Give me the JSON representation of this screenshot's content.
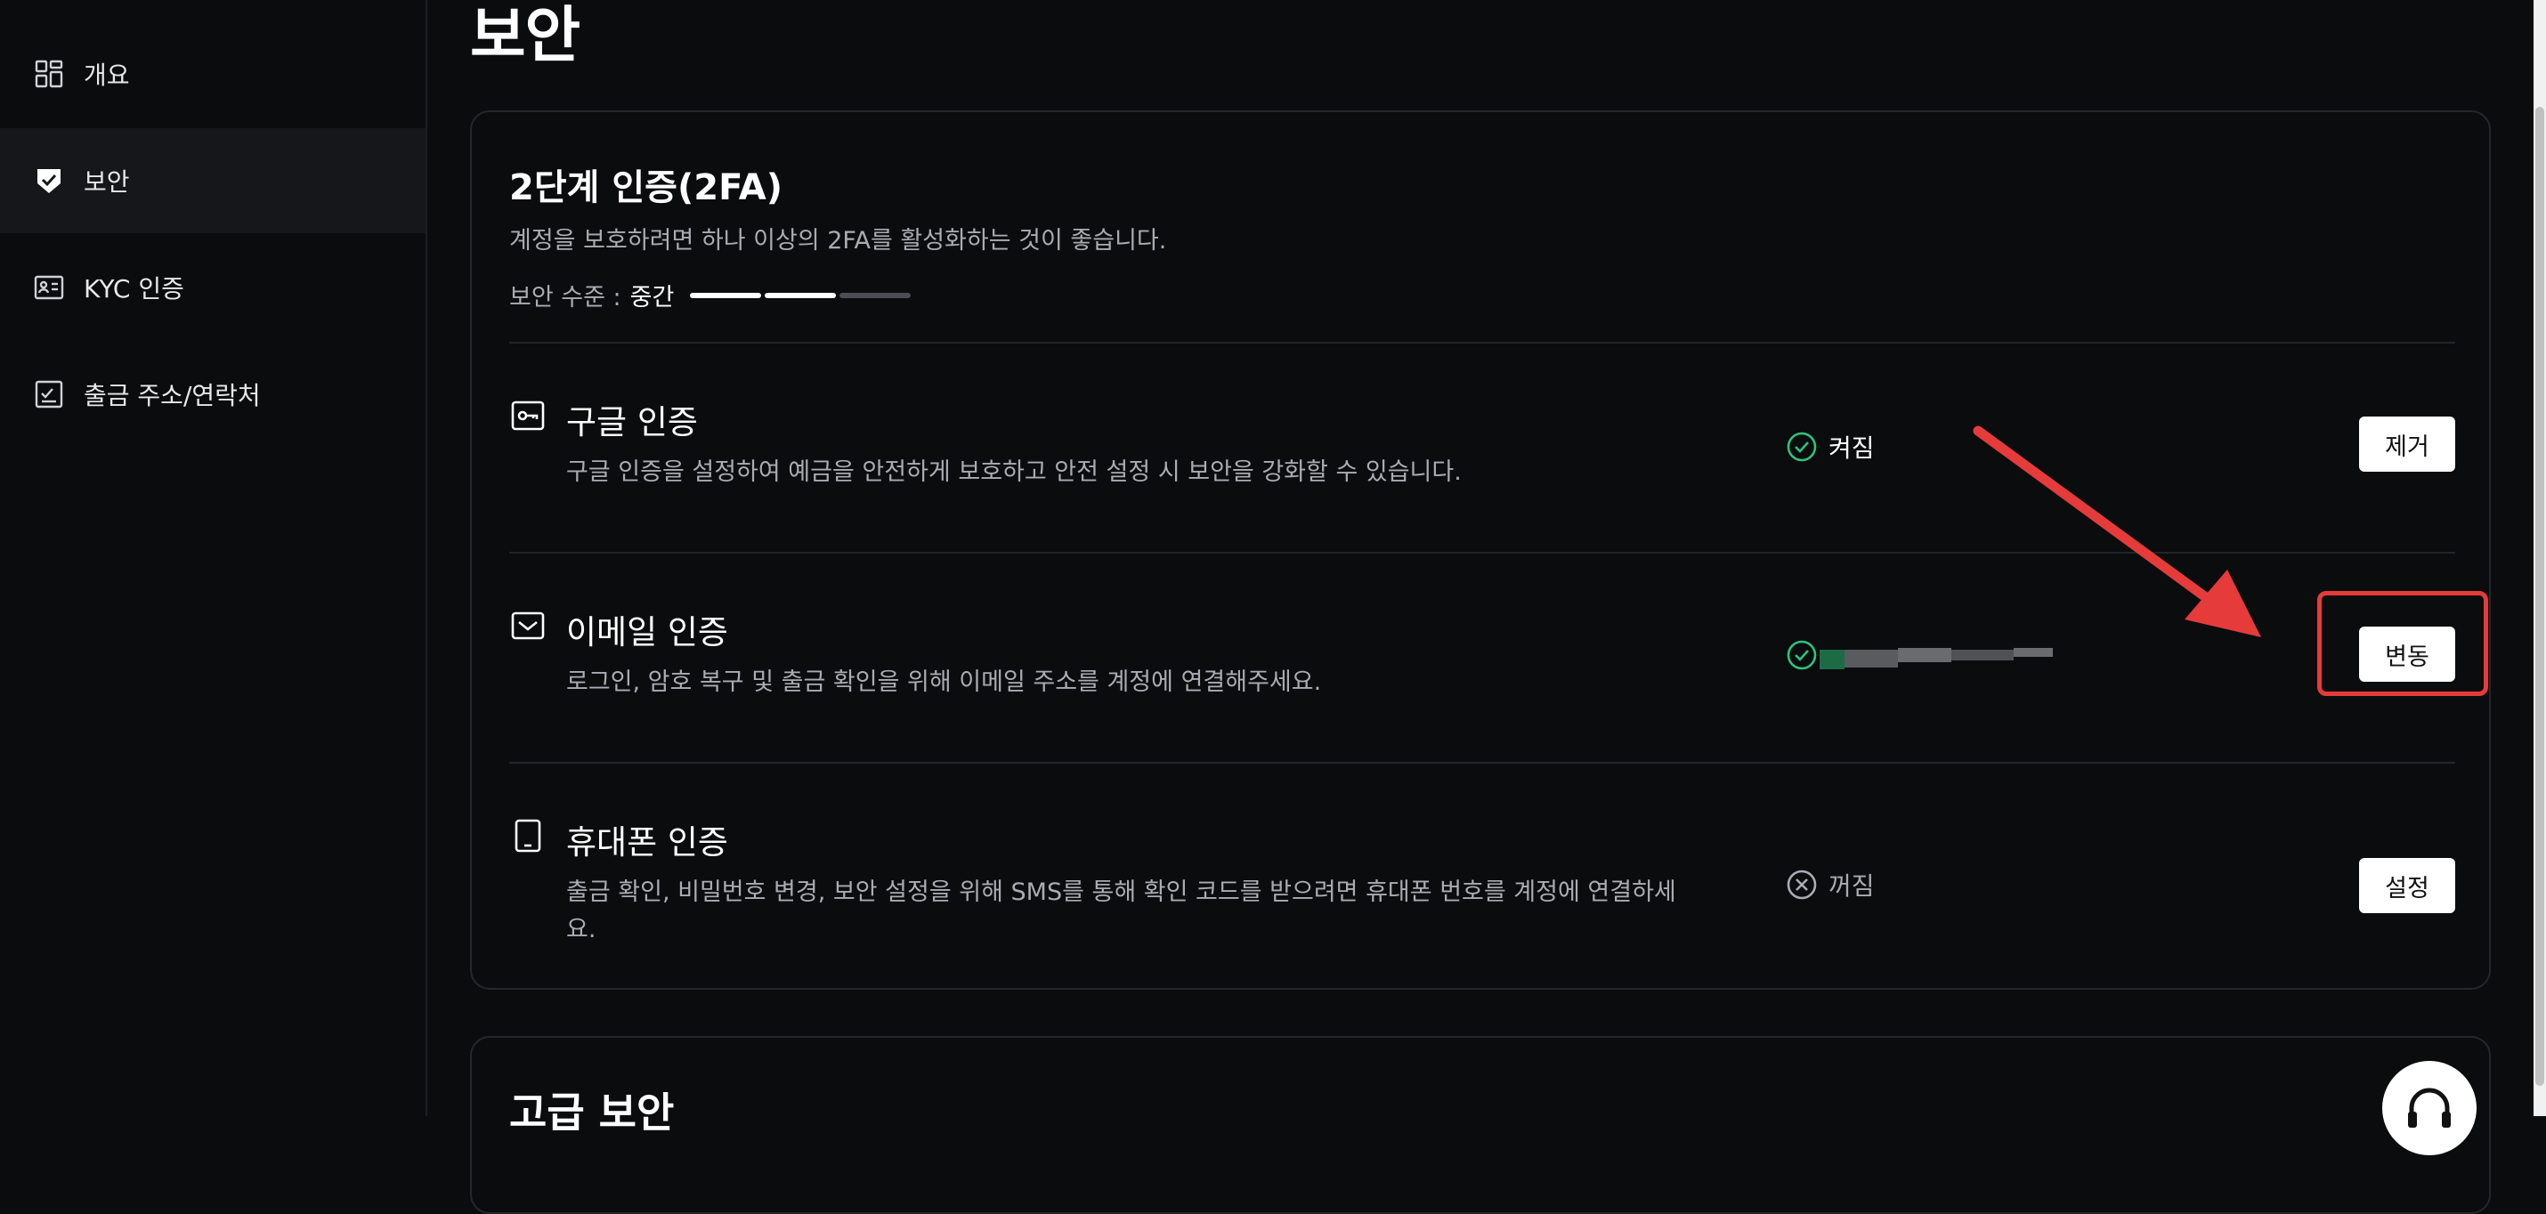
{
  "sidebar": {
    "items": [
      {
        "label": "개요",
        "icon": "dashboard-icon"
      },
      {
        "label": "보안",
        "icon": "shield-check-icon",
        "active": true
      },
      {
        "label": "KYC 인증",
        "icon": "id-card-icon"
      },
      {
        "label": "출금 주소/연락처",
        "icon": "address-book-icon"
      }
    ]
  },
  "page": {
    "title": "보안"
  },
  "twofa": {
    "title": "2단계 인증(2FA)",
    "description": "계정을 보호하려면 하나 이상의 2FA를 활성화하는 것이 좋습니다.",
    "level_label": "보안 수준 :",
    "level_value": "중간",
    "level_filled": 2,
    "level_total": 3,
    "rows": [
      {
        "title": "구글 인증",
        "icon": "key-icon",
        "description": "구글 인증을 설정하여 예금을 안전하게 보호하고 안전 설정 시 보안을 강화할 수 있습니다.",
        "status": "켜짐",
        "status_icon": "check-circle-icon",
        "button": "제거"
      },
      {
        "title": "이메일 인증",
        "icon": "mail-icon",
        "description": "로그인, 암호 복구 및 출금 확인을 위해 이메일 주소를 계정에 연결해주세요.",
        "status": "",
        "status_icon": "check-circle-icon",
        "button": "변동"
      },
      {
        "title": "휴대폰 인증",
        "icon": "phone-icon",
        "description": "출금 확인, 비밀번호 변경, 보안 설정을 위해 SMS를 통해 확인 코드를 받으려면 휴대폰 번호를 계정에 연결하세요.",
        "status": "꺼짐",
        "status_icon": "x-circle-icon",
        "button": "설정"
      }
    ]
  },
  "advanced": {
    "title": "고급 보안"
  },
  "colors": {
    "accent_green": "#2ec27e",
    "highlight_red": "#e53b3b",
    "background": "#0b0c0e"
  }
}
